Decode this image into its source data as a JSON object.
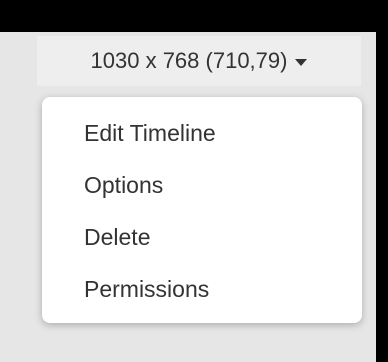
{
  "dims_button": {
    "label": "1030 x 768 (710,79)",
    "caret_icon": "caret-down-icon"
  },
  "menu": {
    "items": [
      {
        "label": "Edit Timeline"
      },
      {
        "label": "Options"
      },
      {
        "label": "Delete"
      },
      {
        "label": "Permissions"
      }
    ]
  },
  "colors": {
    "background": "#000000",
    "panel": "#e6e6e6",
    "button": "#eeeeee",
    "menu": "#ffffff",
    "text": "#333333"
  }
}
